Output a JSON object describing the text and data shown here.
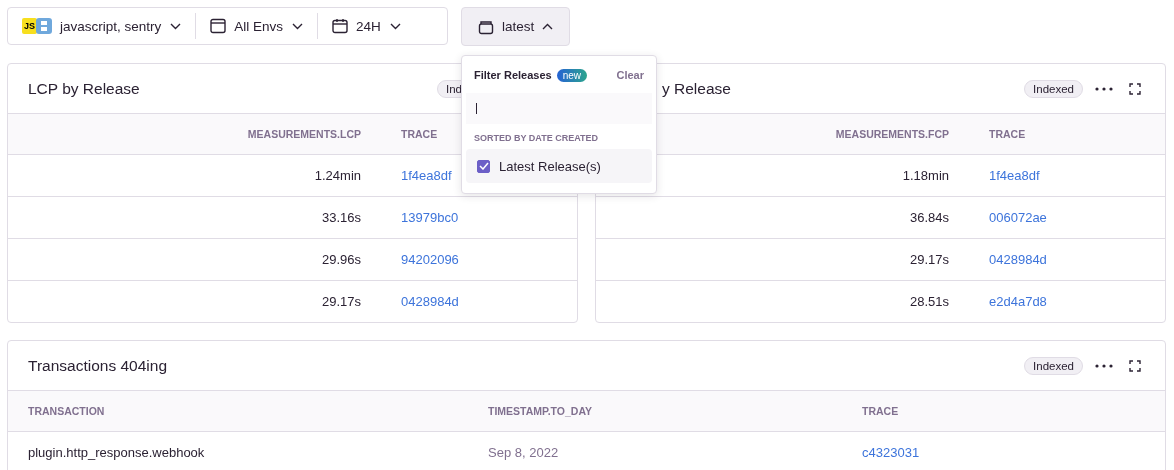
{
  "filters": [
    {
      "kind": "project",
      "label": "javascript, sentry",
      "logo_text": "JS"
    },
    {
      "kind": "environment",
      "label": "All Envs"
    },
    {
      "kind": "period",
      "label": "24H"
    }
  ],
  "release_button": {
    "label": "latest",
    "expanded": true
  },
  "release_menu": {
    "title": "Filter Releases",
    "badge": "new",
    "clear": "Clear",
    "section": "SORTED BY DATE CREATED",
    "options": [
      {
        "label": "Latest Release(s)",
        "checked": true
      }
    ]
  },
  "widgets": [
    {
      "kind": "split",
      "title": "LCP by Release",
      "badge": "Ind",
      "actions": false,
      "columns": [
        {
          "label": "MEASUREMENTS.LCP"
        },
        {
          "label": "TRACE"
        }
      ],
      "rows": [
        [
          {
            "text": "1.24min",
            "kind": "value"
          },
          {
            "text": "1f4ea8df",
            "kind": "link"
          }
        ],
        [
          {
            "text": "33.16s",
            "kind": "value"
          },
          {
            "text": "13979bc0",
            "kind": "link"
          }
        ],
        [
          {
            "text": "29.96s",
            "kind": "value"
          },
          {
            "text": "94202096",
            "kind": "link"
          }
        ],
        [
          {
            "text": "29.17s",
            "kind": "value"
          },
          {
            "text": "0428984d",
            "kind": "link"
          }
        ]
      ]
    },
    {
      "kind": "split",
      "title": "y Release",
      "badge": "Indexed",
      "actions": true,
      "columns": [
        {
          "label": "MEASUREMENTS.FCP"
        },
        {
          "label": "TRACE"
        }
      ],
      "rows": [
        [
          {
            "text": "1.18min",
            "kind": "value"
          },
          {
            "text": "1f4ea8df",
            "kind": "link"
          }
        ],
        [
          {
            "text": "36.84s",
            "kind": "value"
          },
          {
            "text": "006072ae",
            "kind": "link"
          }
        ],
        [
          {
            "text": "29.17s",
            "kind": "value"
          },
          {
            "text": "0428984d",
            "kind": "link"
          }
        ],
        [
          {
            "text": "28.51s",
            "kind": "value"
          },
          {
            "text": "e2d4a7d8",
            "kind": "link"
          }
        ]
      ]
    },
    {
      "kind": "wide",
      "title": "Transactions 404ing",
      "badge": "Indexed",
      "actions": true,
      "columns": [
        {
          "label": "TRANSACTION"
        },
        {
          "label": "TIMESTAMP.TO_DAY"
        },
        {
          "label": "TRACE"
        }
      ],
      "rows": [
        [
          {
            "text": "plugin.http_response.webhook",
            "kind": "value"
          },
          {
            "text": "Sep 8, 2022",
            "kind": "muted"
          },
          {
            "text": "c4323031",
            "kind": "link"
          }
        ]
      ]
    }
  ]
}
